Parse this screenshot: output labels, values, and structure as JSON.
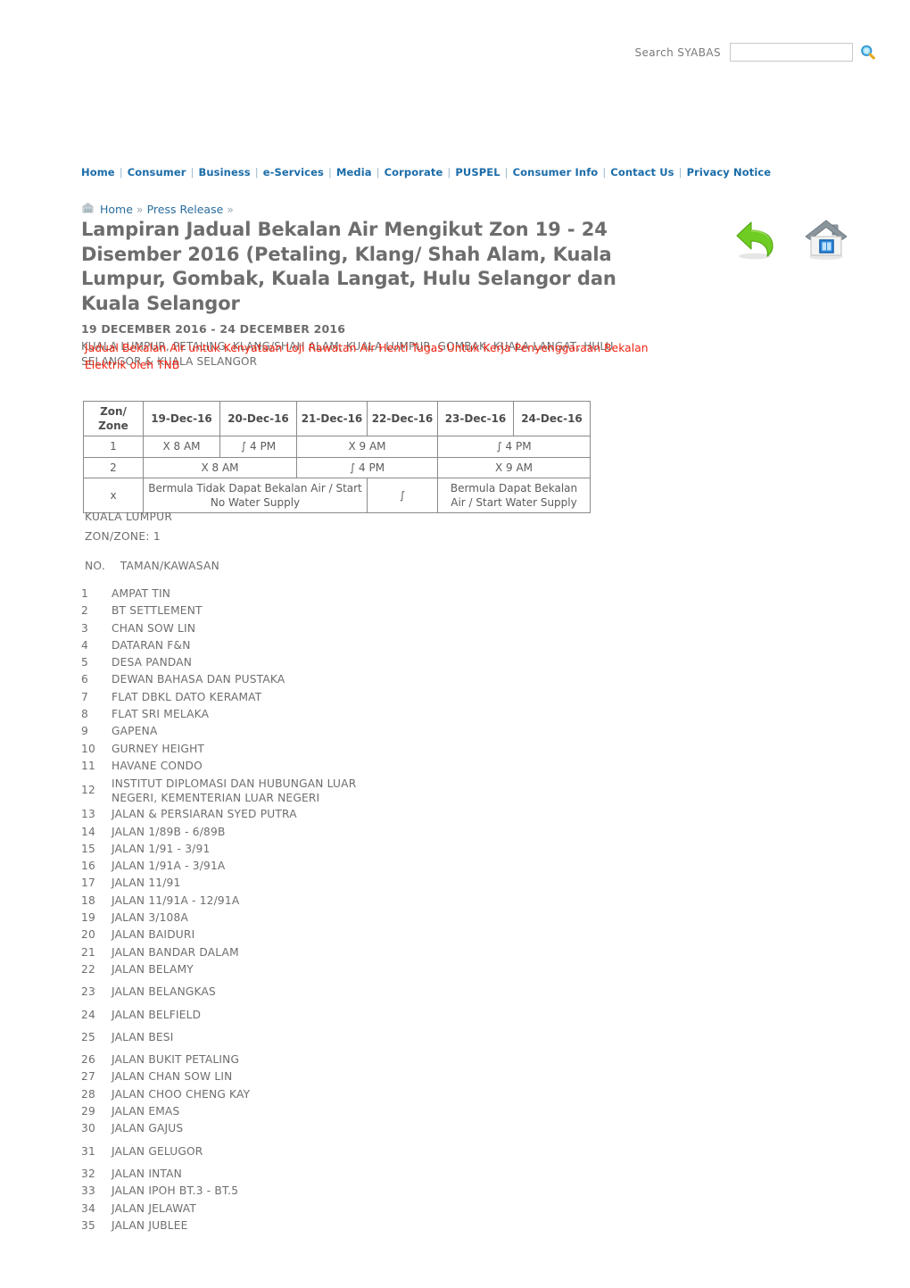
{
  "search": {
    "label": "Search SYABAS",
    "value": "",
    "placeholder": "",
    "icon": "search-icon"
  },
  "nav": {
    "items": [
      "Home",
      "Consumer",
      "Business",
      "e-Services",
      "Media",
      "Corporate",
      "PUSPEL",
      "Consumer Info",
      "Contact Us",
      "Privacy Notice"
    ],
    "separator": "|"
  },
  "breadcrumb": {
    "icon": "home-building-icon",
    "items": [
      "Home",
      "Press Release"
    ],
    "arrow": "»"
  },
  "header": {
    "title": "Lampiran Jadual Bekalan Air Mengikut Zon 19 - 24 Disember 2016 (Petaling, Klang/ Shah Alam, Kuala Lumpur, Gombak, Kuala Langat, Hulu Selangor dan Kuala Selangor",
    "date_range": "19 DECEMBER 2016 - 24 DECEMBER 2016",
    "locations": "KUALA LUMPUR, PETALING, KLANG/SHAH ALAM, KUALA LUMPUR, GOMBAK, KUALA LANGAT, HULU SELANGOR & KUALA SELANGOR"
  },
  "actions": [
    {
      "name": "back-button",
      "icon": "green-back-arrow-icon"
    },
    {
      "name": "home-button",
      "icon": "house-icon"
    }
  ],
  "notice": {
    "text": "Jadual Bekalan Air untuk Kenyataan Loji Rawatan Air Henti Tugas Untuk Kerja Penyenggaraan Bekalan Elektrik oleh TNB",
    "color": "#f4220f"
  },
  "schedule": {
    "headers": [
      "Zon/ Zone",
      "19-Dec-16",
      "20-Dec-16",
      "21-Dec-16",
      "22-Dec-16",
      "23-Dec-16",
      "24-Dec-16"
    ],
    "rows": [
      {
        "zone": "1",
        "cells": [
          {
            "text": "X 8 AM",
            "colspan": 1
          },
          {
            "text": "∫ 4 PM",
            "colspan": 1
          },
          {
            "text": "X 9 AM",
            "colspan": 2
          },
          {
            "text": "∫ 4 PM",
            "colspan": 2
          }
        ]
      },
      {
        "zone": "2",
        "cells": [
          {
            "text": "X 8 AM",
            "colspan": 2
          },
          {
            "text": "∫ 4 PM",
            "colspan": 2
          },
          {
            "text": "X 9 AM",
            "colspan": 2
          }
        ]
      }
    ],
    "legend_row": {
      "zone": "x",
      "cells": [
        {
          "text": "Bermula Tidak Dapat Bekalan Air / Start No Water Supply",
          "colspan": 3
        },
        {
          "text": "∫",
          "colspan": 1
        },
        {
          "text": "Bermula Dapat Bekalan Air / Start Water Supply",
          "colspan": 2
        }
      ]
    }
  },
  "zone_info": {
    "state": "KUALA LUMPUR",
    "zone": "ZON/ZONE: 1"
  },
  "list_header": {
    "no": "NO.",
    "name": "TAMAN/KAWASAN"
  },
  "areas": [
    {
      "no": "1",
      "name": "AMPAT TIN"
    },
    {
      "no": "2",
      "name": "BT SETTLEMENT"
    },
    {
      "no": "3",
      "name": "CHAN SOW LIN"
    },
    {
      "no": "4",
      "name": "DATARAN F&N"
    },
    {
      "no": "5",
      "name": "DESA PANDAN"
    },
    {
      "no": "6",
      "name": "DEWAN BAHASA DAN PUSTAKA"
    },
    {
      "no": "7",
      "name": "FLAT DBKL DATO KERAMAT"
    },
    {
      "no": "8",
      "name": "FLAT SRI MELAKA"
    },
    {
      "no": "9",
      "name": "GAPENA"
    },
    {
      "no": "10",
      "name": "GURNEY HEIGHT"
    },
    {
      "no": "11",
      "name": "HAVANE CONDO"
    },
    {
      "no": "12",
      "name": "INSTITUT DIPLOMASI DAN HUBUNGAN LUAR NEGERI, KEMENTERIAN LUAR NEGERI",
      "wide": true
    },
    {
      "no": "13",
      "name": "JALAN & PERSIARAN SYED PUTRA"
    },
    {
      "no": "14",
      "name": "JALAN 1/89B - 6/89B"
    },
    {
      "no": "15",
      "name": "JALAN 1/91 - 3/91"
    },
    {
      "no": "16",
      "name": "JALAN 1/91A - 3/91A"
    },
    {
      "no": "17",
      "name": "JALAN 11/91"
    },
    {
      "no": "18",
      "name": "JALAN 11/91A - 12/91A"
    },
    {
      "no": "19",
      "name": "JALAN 3/108A"
    },
    {
      "no": "20",
      "name": "JALAN BAIDURI"
    },
    {
      "no": "21",
      "name": "JALAN BANDAR DALAM"
    },
    {
      "no": "22",
      "name": "JALAN BELAMY"
    },
    {
      "no": "23",
      "name": "JALAN BELANGKAS",
      "gap": true
    },
    {
      "no": "24",
      "name": "JALAN BELFIELD",
      "gap": true
    },
    {
      "no": "25",
      "name": "JALAN BESI",
      "gap": true
    },
    {
      "no": "26",
      "name": "JALAN BUKIT PETALING",
      "gap": true
    },
    {
      "no": "27",
      "name": "JALAN CHAN SOW LIN"
    },
    {
      "no": "28",
      "name": "JALAN CHOO CHENG KAY"
    },
    {
      "no": "29",
      "name": "JALAN EMAS"
    },
    {
      "no": "30",
      "name": "JALAN GAJUS"
    },
    {
      "no": "31",
      "name": "JALAN GELUGOR",
      "gap": true
    },
    {
      "no": "32",
      "name": "JALAN INTAN",
      "gap": true
    },
    {
      "no": "33",
      "name": "JALAN IPOH BT.3 - BT.5"
    },
    {
      "no": "34",
      "name": "JALAN JELAWAT"
    },
    {
      "no": "35",
      "name": "JALAN JUBLEE"
    }
  ]
}
